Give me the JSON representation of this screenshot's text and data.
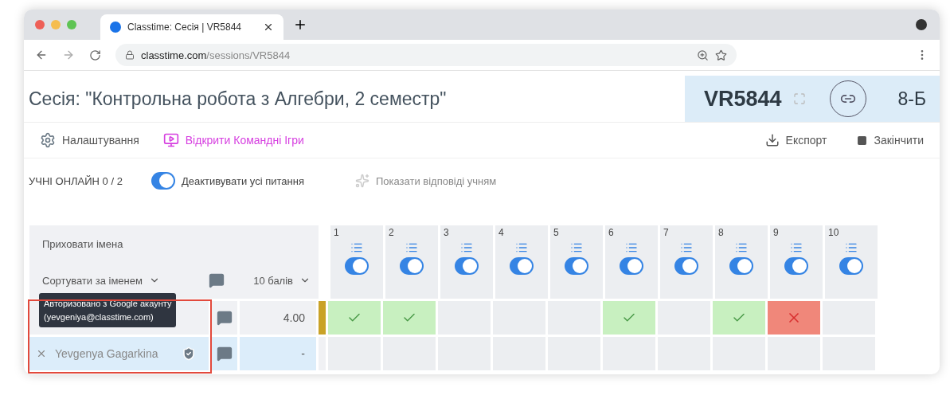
{
  "browser": {
    "tab_title": "Classtime: Сесія | VR5844",
    "url_domain": "classtime.com",
    "url_path": "/sessions/VR5844"
  },
  "session": {
    "title": "Сесія: \"Контрольна робота з Алгебри, 2 семестр\"",
    "code": "VR5844",
    "class_name": "8-Б"
  },
  "toolbar": {
    "settings": "Налаштування",
    "team_games": "Відкрити Командні Ігри",
    "export": "Експорт",
    "finish": "Закінчити"
  },
  "options": {
    "online": "УЧНІ ОНЛАЙН 0 / 2",
    "deactivate": {
      "label": "Деактивувати усі питання",
      "on": true
    },
    "show_answers": "Показати відповіді учням"
  },
  "grid": {
    "hide_names": "Приховати імена",
    "sort": "Сортувати за іменем",
    "points": "10 балів",
    "questions": [
      {
        "number": "1",
        "on": true
      },
      {
        "number": "2",
        "on": true
      },
      {
        "number": "3",
        "on": true
      },
      {
        "number": "4",
        "on": true
      },
      {
        "number": "5",
        "on": true
      },
      {
        "number": "6",
        "on": true
      },
      {
        "number": "7",
        "on": true
      },
      {
        "number": "8",
        "on": true
      },
      {
        "number": "9",
        "on": true
      },
      {
        "number": "10",
        "on": true
      }
    ],
    "students": [
      {
        "tooltip": [
          "Авторизовано з Google акаунту",
          "(yevgeniya@classtime.com)"
        ],
        "score": "4.00",
        "selected": false,
        "submitted": true,
        "results": [
          {
            "kind": "correct"
          },
          {
            "kind": "correct"
          },
          {
            "kind": "empty"
          },
          {
            "kind": "empty"
          },
          {
            "kind": "empty"
          },
          {
            "kind": "correct"
          },
          {
            "kind": "empty"
          },
          {
            "kind": "correct"
          },
          {
            "kind": "wrong"
          },
          {
            "kind": "empty"
          }
        ]
      },
      {
        "name": "Yevgenya Gagarkina",
        "score": "-",
        "selected": true,
        "submitted": false,
        "results": [
          {
            "kind": "empty"
          },
          {
            "kind": "empty"
          },
          {
            "kind": "empty"
          },
          {
            "kind": "empty"
          },
          {
            "kind": "empty"
          },
          {
            "kind": "empty"
          },
          {
            "kind": "empty"
          },
          {
            "kind": "empty"
          },
          {
            "kind": "empty"
          },
          {
            "kind": "empty"
          }
        ]
      }
    ]
  }
}
